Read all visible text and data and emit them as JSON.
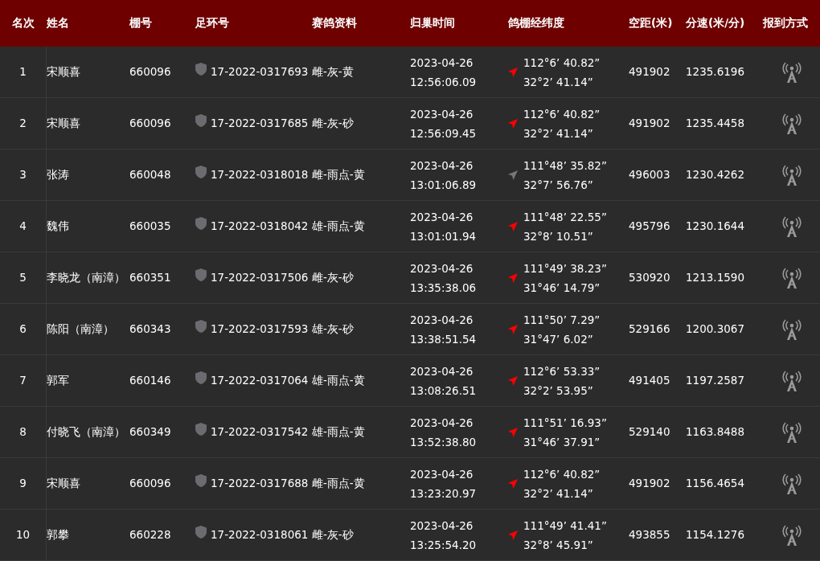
{
  "columns": [
    "名次",
    "姓名",
    "棚号",
    "足环号",
    "赛鸽资料",
    "归巢时间",
    "鸽棚经纬度",
    "空距(米)",
    "分速(米/分)",
    "报到方式"
  ],
  "rows": [
    {
      "rank": "1",
      "name": "宋顺喜",
      "coop": "660096",
      "ring": "17-2022-0317693",
      "info": "雌-灰-黄",
      "date": "2023-04-26",
      "time": "12:56:06.09",
      "color": "#ff0000",
      "lon": "112°6’ 40.82”",
      "lat": "32°2’ 41.14”",
      "distance": "491902",
      "speed": "1235.6196"
    },
    {
      "rank": "2",
      "name": "宋顺喜",
      "coop": "660096",
      "ring": "17-2022-0317685",
      "info": "雌-灰-砂",
      "date": "2023-04-26",
      "time": "12:56:09.45",
      "color": "#ff0000",
      "lon": "112°6’ 40.82”",
      "lat": "32°2’ 41.14”",
      "distance": "491902",
      "speed": "1235.4458"
    },
    {
      "rank": "3",
      "name": "张涛",
      "coop": "660048",
      "ring": "17-2022-0318018",
      "info": "雌-雨点-黄",
      "date": "2023-04-26",
      "time": "13:01:06.89",
      "color": "#777777",
      "lon": "111°48’ 35.82”",
      "lat": "32°7’ 56.76”",
      "distance": "496003",
      "speed": "1230.4262"
    },
    {
      "rank": "4",
      "name": "魏伟",
      "coop": "660035",
      "ring": "17-2022-0318042",
      "info": "雄-雨点-黄",
      "date": "2023-04-26",
      "time": "13:01:01.94",
      "color": "#ff0000",
      "lon": "111°48’ 22.55”",
      "lat": "32°8’ 10.51”",
      "distance": "495796",
      "speed": "1230.1644"
    },
    {
      "rank": "5",
      "name": "李晓龙（南漳）",
      "coop": "660351",
      "ring": "17-2022-0317506",
      "info": "雌-灰-砂",
      "date": "2023-04-26",
      "time": "13:35:38.06",
      "color": "#ff0000",
      "lon": "111°49’ 38.23”",
      "lat": "31°46’ 14.79”",
      "distance": "530920",
      "speed": "1213.1590"
    },
    {
      "rank": "6",
      "name": "陈阳（南漳）",
      "coop": "660343",
      "ring": "17-2022-0317593",
      "info": "雄-灰-砂",
      "date": "2023-04-26",
      "time": "13:38:51.54",
      "color": "#ff0000",
      "lon": "111°50’ 7.29”",
      "lat": "31°47’ 6.02”",
      "distance": "529166",
      "speed": "1200.3067"
    },
    {
      "rank": "7",
      "name": "郭军",
      "coop": "660146",
      "ring": "17-2022-0317064",
      "info": "雄-雨点-黄",
      "date": "2023-04-26",
      "time": "13:08:26.51",
      "color": "#ff0000",
      "lon": "112°6’ 53.33”",
      "lat": "32°2’ 53.95”",
      "distance": "491405",
      "speed": "1197.2587"
    },
    {
      "rank": "8",
      "name": "付晓飞（南漳）",
      "coop": "660349",
      "ring": "17-2022-0317542",
      "info": "雄-雨点-黄",
      "date": "2023-04-26",
      "time": "13:52:38.80",
      "color": "#ff0000",
      "lon": "111°51’ 16.93”",
      "lat": "31°46’ 37.91”",
      "distance": "529140",
      "speed": "1163.8488"
    },
    {
      "rank": "9",
      "name": "宋顺喜",
      "coop": "660096",
      "ring": "17-2022-0317688",
      "info": "雌-雨点-黄",
      "date": "2023-04-26",
      "time": "13:23:20.97",
      "color": "#ff0000",
      "lon": "112°6’ 40.82”",
      "lat": "32°2’ 41.14”",
      "distance": "491902",
      "speed": "1156.4654"
    },
    {
      "rank": "10",
      "name": "郭攀",
      "coop": "660228",
      "ring": "17-2022-0318061",
      "info": "雌-灰-砂",
      "date": "2023-04-26",
      "time": "13:25:54.20",
      "color": "#ff0000",
      "lon": "111°49’ 41.41”",
      "lat": "32°8’ 45.91”",
      "distance": "493855",
      "speed": "1154.1276"
    }
  ]
}
